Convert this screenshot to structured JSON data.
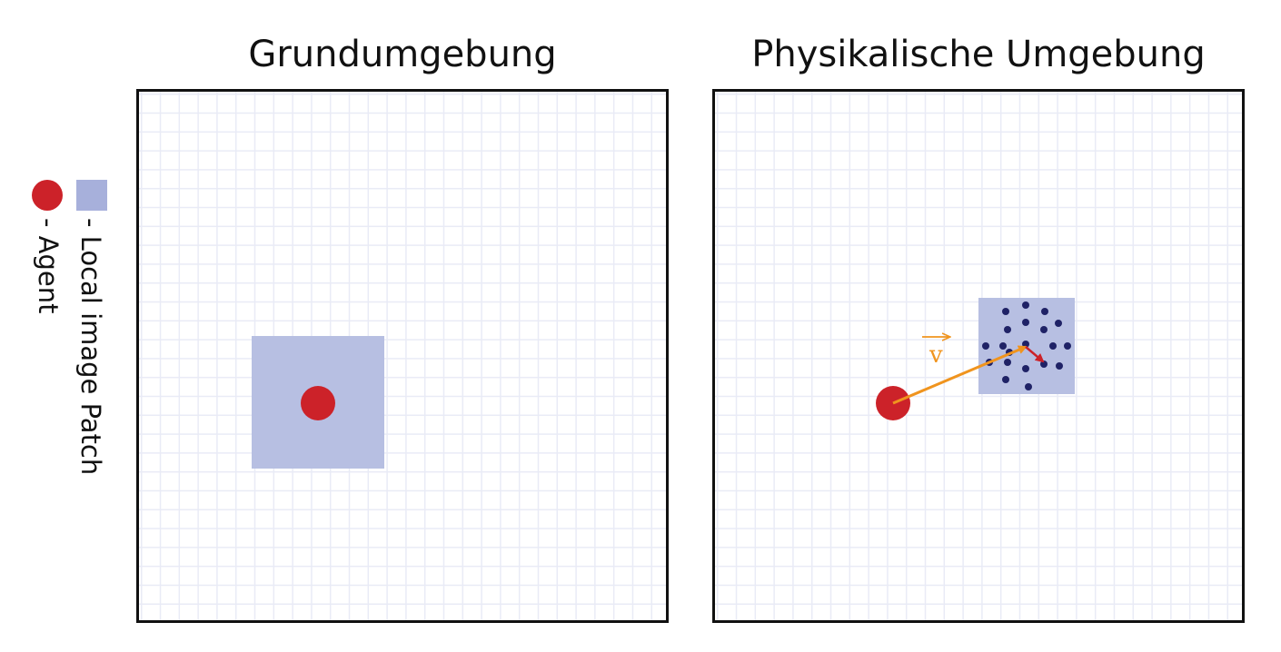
{
  "panels": {
    "left": {
      "title": "Grundumgebung"
    },
    "right": {
      "title": "Physikalische Umgebung",
      "velocity_label": "v"
    }
  },
  "legend": {
    "agent_label": "- Agent",
    "patch_label": "- Local image Patch"
  },
  "colors": {
    "agent": "#cc2229",
    "patch": "#b7bfe2",
    "grid": "#e9ebf6",
    "particles": "#1f2266",
    "velocity_arrow": "#f0941e",
    "particle_arrow": "#cc2229"
  }
}
